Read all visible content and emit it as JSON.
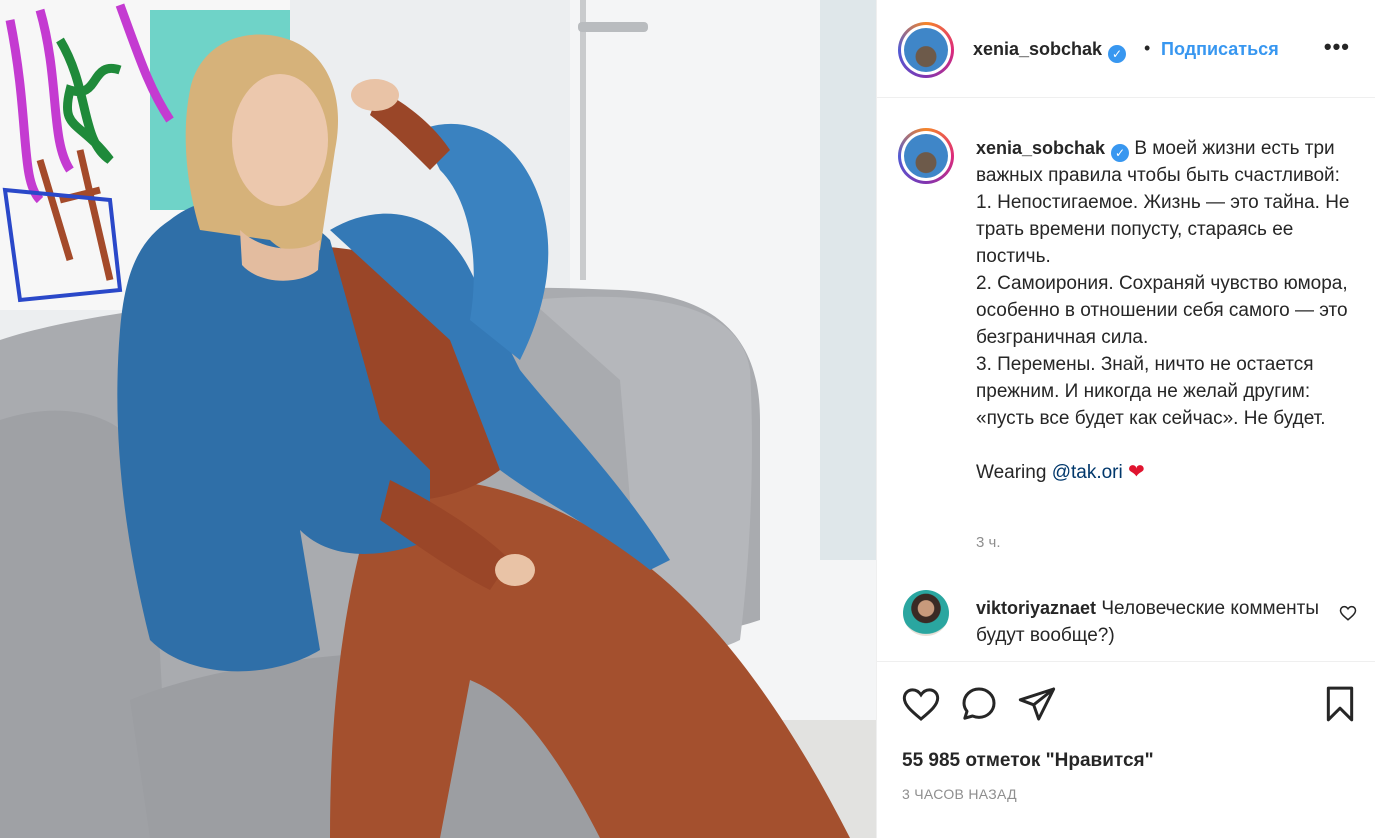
{
  "post": {
    "username": "xenia_sobchak",
    "verified_mark": "✓",
    "separator": "•",
    "follow_label": "Подписаться",
    "more_label": "•••"
  },
  "caption": {
    "username": "xenia_sobchak",
    "text": "В моей жизни есть три важных правила чтобы быть счастливой:\n1. Непостигаемое. Жизнь — это тайна. Не трать времени попусту, стараясь ее постичь.\n2. Самоирония. Сохраняй чувство юмора, особенно в отношении себя самого — это безграничная сила.\n3. Перемены. Знай, ничто не остается прежним. И никогда не желай другим: «пусть все будет как сейчас». Не будет.\n\nWearing ",
    "mention": "@tak.ori",
    "emoji": "❤",
    "time": "3 ч."
  },
  "comment": {
    "username": "viktoriyaznaet",
    "text": "Человеческие комменты будут вообще?)"
  },
  "actions": {
    "likes": "55 985 отметок \"Нравится\"",
    "posted": "3 ЧАСОВ НАЗАД"
  },
  "colors": {
    "accent": "#3897f0",
    "mention": "#00376b",
    "muted": "#8e8e8e",
    "jacket": "#2f6fa8",
    "outfit": "#a4502e",
    "chair": "#a7a9ad"
  },
  "icons": [
    "verified-badge-icon",
    "more-icon",
    "heart-icon",
    "comment-icon",
    "share-icon",
    "bookmark-icon"
  ]
}
